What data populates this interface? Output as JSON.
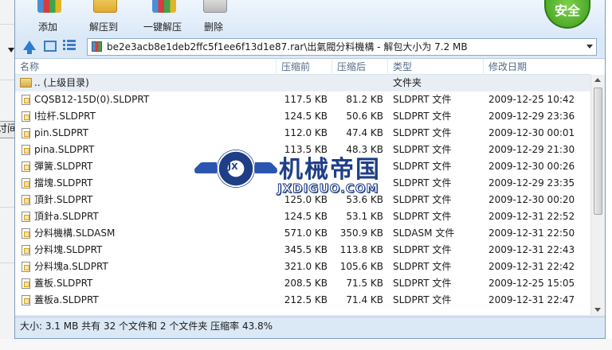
{
  "toolbar": {
    "add_label": "添加",
    "extract_label": "解压到",
    "onekey_label": "一键解压",
    "delete_label": "删除",
    "security_label": "安全"
  },
  "address": {
    "path": "be2e3acb8e1deb2ffc5f1ee6f13d1e87.rar\\出氣閥分料機構 - 解包大小为 7.2 MB"
  },
  "columns": {
    "name": "名称",
    "packed": "压缩前",
    "unpacked": "压缩后",
    "type": "类型",
    "modified": "修改日期"
  },
  "files": [
    {
      "name": ".. (上级目录)",
      "packed": "",
      "unpacked": "",
      "type": "文件夹",
      "modified": ""
    },
    {
      "name": "CQSB12-15D(0).SLDPRT",
      "packed": "117.5 KB",
      "unpacked": "81.2 KB",
      "type": "SLDPRT 文件",
      "modified": "2009-12-25 10:42"
    },
    {
      "name": "I拉杆.SLDPRT",
      "packed": "124.5 KB",
      "unpacked": "50.6 KB",
      "type": "SLDPRT 文件",
      "modified": "2009-12-29 23:36"
    },
    {
      "name": "pin.SLDPRT",
      "packed": "112.0 KB",
      "unpacked": "47.4 KB",
      "type": "SLDPRT 文件",
      "modified": "2009-12-30 00:01"
    },
    {
      "name": "pina.SLDPRT",
      "packed": "113.5 KB",
      "unpacked": "48.3 KB",
      "type": "SLDPRT 文件",
      "modified": "2009-12-29 21:30"
    },
    {
      "name": "彈簧.SLDPRT",
      "packed": "",
      "unpacked": "",
      "type": "SLDPRT 文件",
      "modified": "2009-12-30 00:26"
    },
    {
      "name": "擋塊.SLDPRT",
      "packed": "",
      "unpacked": "",
      "type": "SLDPRT 文件",
      "modified": "2009-12-29 23:35"
    },
    {
      "name": "頂針.SLDPRT",
      "packed": "125.0 KB",
      "unpacked": "53.6 KB",
      "type": "SLDPRT 文件",
      "modified": "2009-12-30 00:20"
    },
    {
      "name": "頂針a.SLDPRT",
      "packed": "124.5 KB",
      "unpacked": "53.1 KB",
      "type": "SLDPRT 文件",
      "modified": "2009-12-31 22:52"
    },
    {
      "name": "分料機構.SLDASM",
      "packed": "571.0 KB",
      "unpacked": "350.9 KB",
      "type": "SLDASM 文件",
      "modified": "2009-12-31 22:50"
    },
    {
      "name": "分料塊.SLDPRT",
      "packed": "345.5 KB",
      "unpacked": "113.8 KB",
      "type": "SLDPRT 文件",
      "modified": "2009-12-31 22:43"
    },
    {
      "name": "分料塊a.SLDPRT",
      "packed": "321.0 KB",
      "unpacked": "105.6 KB",
      "type": "SLDPRT 文件",
      "modified": "2009-12-31 22:42"
    },
    {
      "name": "蓋板.SLDPRT",
      "packed": "208.5 KB",
      "unpacked": "71.5 KB",
      "type": "SLDPRT 文件",
      "modified": "2009-12-25 15:05"
    },
    {
      "name": "蓋板a.SLDPRT",
      "packed": "212.5 KB",
      "unpacked": "71.4 KB",
      "type": "SLDPRT 文件",
      "modified": "2009-12-31 22:47"
    }
  ],
  "status": {
    "text": "大小: 3.1 MB 共有 32 个文件和 2 个文件夹 压缩率 43.8%"
  },
  "watermark": {
    "title": "机械帝国",
    "url": "JXDIGUO.COM",
    "badge": "JX"
  },
  "background": {
    "partial_text": "讨间"
  },
  "colors": {
    "window_bg": "#dbe8f6",
    "header_text": "#556b8a",
    "security_green": "#3c9a1f",
    "watermark_blue": "#1f3e86"
  }
}
